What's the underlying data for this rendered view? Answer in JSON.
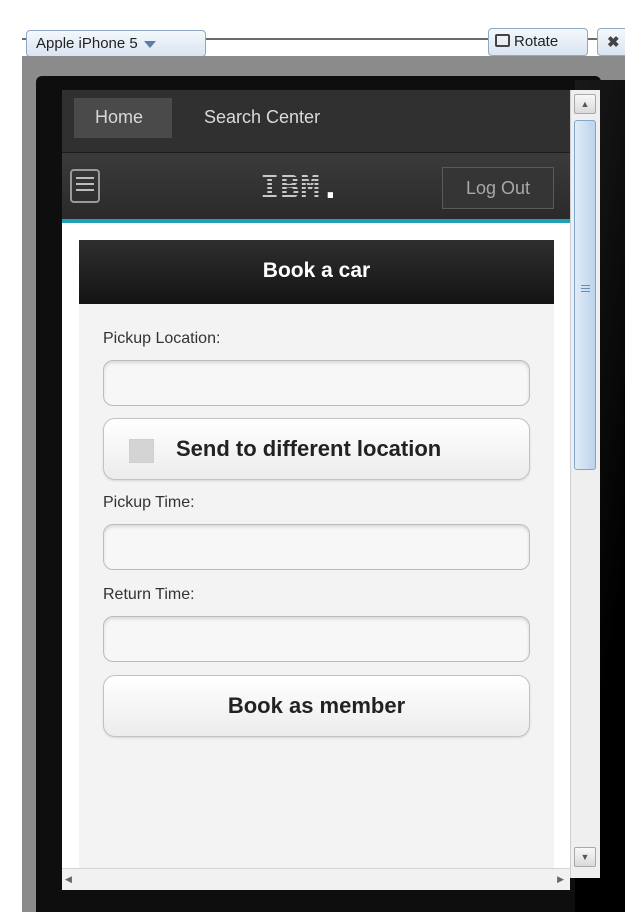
{
  "simulator": {
    "device_label": "Apple iPhone 5",
    "rotate_label": "Rotate",
    "close_glyph": "✖"
  },
  "topnav": {
    "tabs": [
      {
        "label": "Home",
        "active": true
      },
      {
        "label": "Search Center",
        "active": false
      }
    ]
  },
  "header": {
    "menu_icon": "hamburger-menu-icon",
    "logo_text": "IBM",
    "logo_dot": ".",
    "logout_label": "Log Out",
    "accent_color": "#1fa0b8"
  },
  "form": {
    "title": "Book a car",
    "pickup_location_label": "Pickup Location:",
    "pickup_location_value": "",
    "different_location_label": "Send to different location",
    "different_location_checked": false,
    "pickup_time_label": "Pickup Time:",
    "pickup_time_value": "",
    "return_time_label": "Return Time:",
    "return_time_value": "",
    "submit_label": "Book as member"
  },
  "scrollbars": {
    "up_glyph": "▲",
    "down_glyph": "▼",
    "left_glyph": "◀",
    "right_glyph": "▶"
  }
}
